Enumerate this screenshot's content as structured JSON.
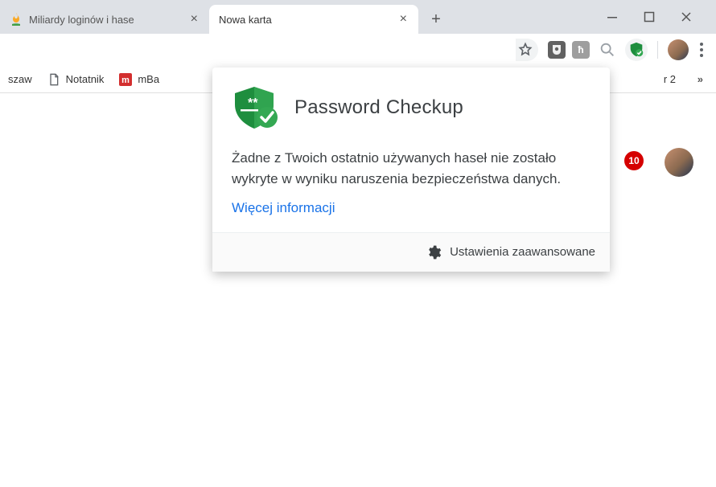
{
  "tabs": [
    {
      "title": "Miliardy loginów i hase",
      "favicon": "flame-icon",
      "active": false
    },
    {
      "title": "Nowa karta",
      "favicon": "",
      "active": true
    }
  ],
  "window_controls": {
    "minimize": "—",
    "maximize": "▢",
    "close": "✕"
  },
  "toolbar": {
    "star_tooltip": "Bookmark",
    "extensions": {
      "ublock": "uO",
      "rh": "R",
      "lens": "lens",
      "password_checkup": "pwc"
    }
  },
  "bookmarks": {
    "truncated_left": "szaw",
    "items": [
      {
        "label": "Notatnik",
        "icon": "doc-icon"
      },
      {
        "label": "mBa",
        "icon": "mbank-icon"
      }
    ],
    "truncated_right": "r 2",
    "overflow": "»"
  },
  "page": {
    "notification_count": "10"
  },
  "popup": {
    "title": "Password Checkup",
    "body": "Żadne z Twoich ostatnio używanych haseł nie zostało wykryte w wyniku naruszenia bezpieczeństwa danych.",
    "link": "Więcej informacji",
    "footer": "Ustawienia zaawansowane"
  }
}
